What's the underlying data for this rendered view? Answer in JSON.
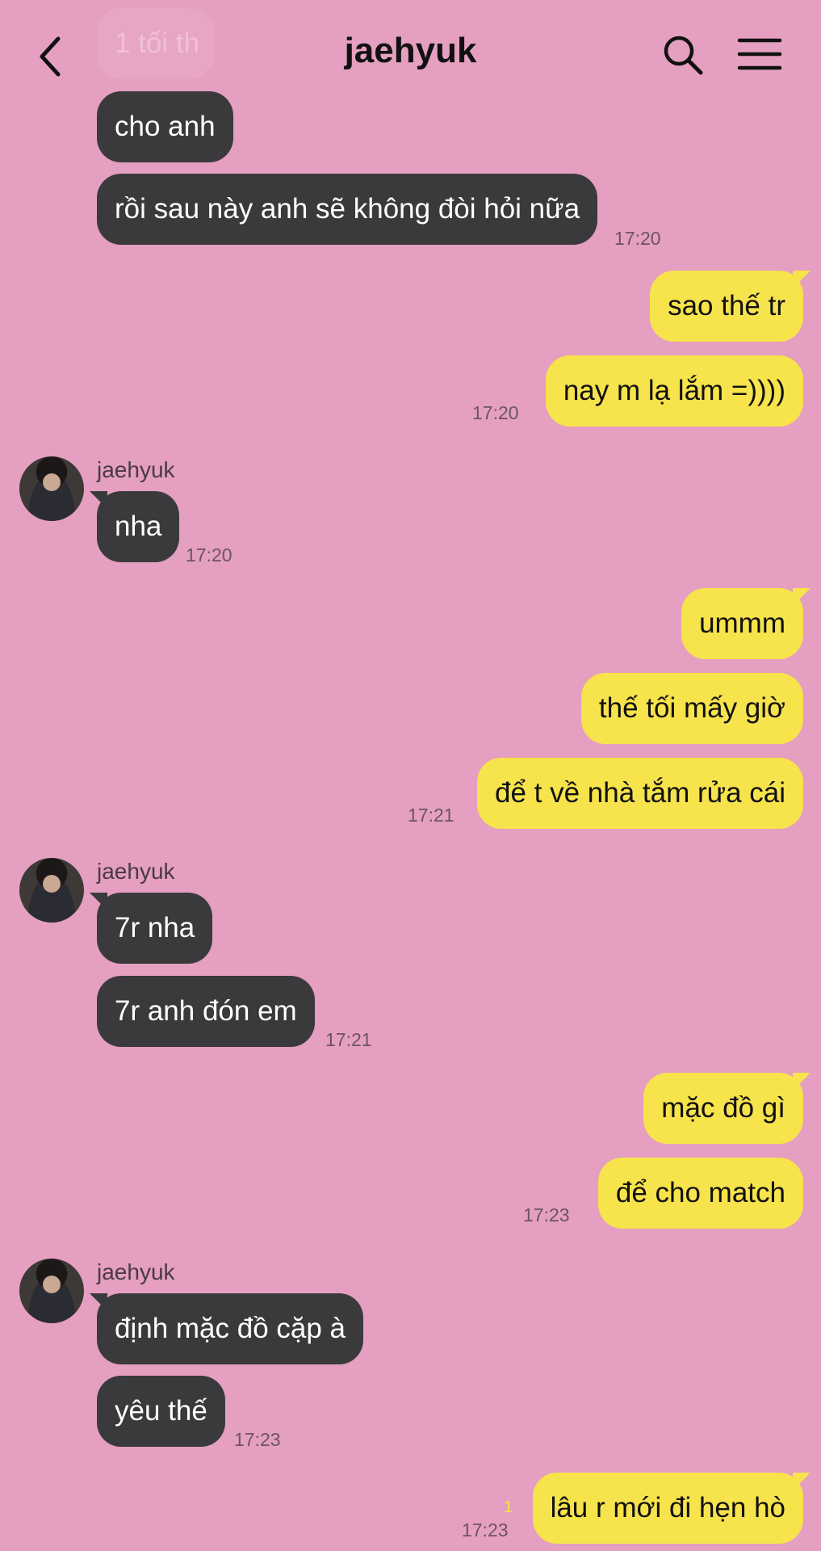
{
  "header": {
    "title": "jaehyuk",
    "back_icon": "chevron-left-icon",
    "search_icon": "search-icon",
    "menu_icon": "hamburger-menu-icon"
  },
  "colors": {
    "background": "#e59fc0",
    "incoming_bubble": "#3a3a3c",
    "outgoing_bubble": "#f7e34b"
  },
  "messages": [
    {
      "direction": "in",
      "text": "1 tối th",
      "faded": true
    },
    {
      "direction": "in",
      "text": "cho anh"
    },
    {
      "direction": "in",
      "text": "rồi sau này anh sẽ không đòi hỏi nữa",
      "time": "17:20"
    },
    {
      "direction": "out",
      "text": "sao thế tr"
    },
    {
      "direction": "out",
      "text": "nay m lạ lắm =))))",
      "time": "17:20"
    },
    {
      "direction": "in",
      "sender": "jaehyuk",
      "text": "nha",
      "time": "17:20"
    },
    {
      "direction": "out",
      "text": "ummm"
    },
    {
      "direction": "out",
      "text": "thế tối mấy giờ"
    },
    {
      "direction": "out",
      "text": "để t về nhà tắm rửa cái",
      "time": "17:21"
    },
    {
      "direction": "in",
      "sender": "jaehyuk",
      "text": "7r nha"
    },
    {
      "direction": "in",
      "text": "7r anh đón em",
      "time": "17:21"
    },
    {
      "direction": "out",
      "text": "mặc đồ gì"
    },
    {
      "direction": "out",
      "text": "để cho match",
      "time": "17:23"
    },
    {
      "direction": "in",
      "sender": "jaehyuk",
      "text": "định mặc đồ cặp à"
    },
    {
      "direction": "in",
      "text": "yêu thế",
      "time": "17:23"
    },
    {
      "direction": "out",
      "text": "lâu r mới đi hẹn hò",
      "time": "17:23",
      "unread": "1"
    }
  ]
}
